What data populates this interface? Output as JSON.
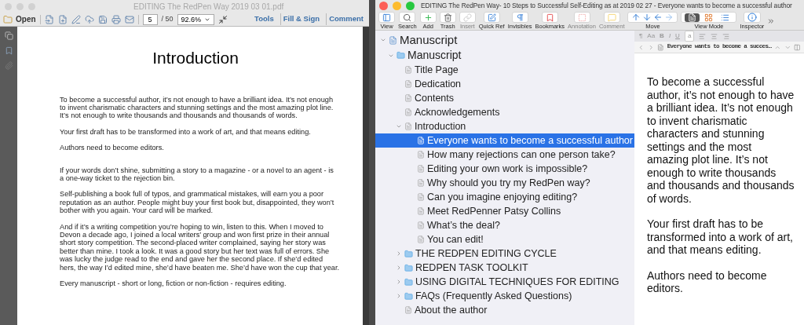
{
  "pdf_window": {
    "title": "EDITING The RedPen Way 2019 03 01.pdf",
    "toolbar": {
      "open": "Open",
      "page": "5",
      "page_total": "/ 50",
      "zoom": "92.6%",
      "links": [
        "Tools",
        "Fill & Sign",
        "Comment"
      ]
    },
    "page": {
      "heading": "Introduction",
      "paragraphs": [
        "To become a successful author, it’s not enough to have a brilliant idea. It’s not enough to invent charismatic characters and stunning settings and the most amazing plot line. It’s not enough to write thousands and thousands and thousands of words.",
        "Your first draft has to be transformed into a work of art, and that means editing.",
        "Authors need to become editors.",
        "If your words don’t shine, submitting a story to a magazine - or a novel to an agent - is a one-way ticket to the rejection bin.",
        "Self-publishing a book full of typos, and grammatical mistakes, will earn you a poor reputation as an author. People might buy your first book but, disappointed, they won’t bother with you again. Your card will be marked.",
        "And if it’s a writing competition you’re hoping to win, listen to this. When I moved to Devon a decade ago, I joined a local writers’ group and won first prize in their annual short story competition. The second-placed writer complained, saying her story was better than mine. I took a look. It was a good story but her text was full of errors. She was lucky the judge read to the end and gave her the second place. If she’d edited hers, the way I’d edited mine, she’d have beaten me. She’d have won the cup that year.",
        "Every manuscript - short or long, fiction or non-fiction - requires editing."
      ]
    }
  },
  "scrivener_window": {
    "title": "EDITING The RedPen Way- 10 Steps to Successful Self-Editing as at 2019 02 27 - Everyone wants to become a successful author",
    "toolbar": [
      {
        "kind": "view",
        "label": "View",
        "disabled": false
      },
      {
        "kind": "search",
        "label": "Search",
        "disabled": false
      },
      {
        "kind": "add",
        "label": "Add",
        "disabled": false
      },
      {
        "kind": "trash",
        "label": "Trash",
        "disabled": false
      },
      {
        "kind": "insert",
        "label": "Insert",
        "disabled": true
      },
      {
        "kind": "quickref",
        "label": "Quick Ref",
        "disabled": false
      },
      {
        "kind": "invisibles",
        "label": "Invisibles",
        "disabled": false
      },
      {
        "kind": "bookmarks",
        "label": "Bookmarks",
        "disabled": false
      },
      {
        "kind": "annotation",
        "label": "Annotation",
        "disabled": true
      },
      {
        "kind": "comment",
        "label": "Comment",
        "disabled": true
      },
      {
        "kind": "move",
        "label": "Move",
        "disabled": false
      },
      {
        "kind": "viewmode",
        "label": "View Mode",
        "disabled": false
      },
      {
        "kind": "inspector",
        "label": "Inspector",
        "disabled": false
      }
    ],
    "binder": [
      {
        "kind": "root",
        "label": "Manuscript",
        "expanded": true,
        "selected": false,
        "children": [
          {
            "kind": "folder",
            "label": "Manuscript",
            "expanded": true,
            "selected": false,
            "children": [
              {
                "kind": "doc",
                "label": "Title Page",
                "selected": false
              },
              {
                "kind": "doc",
                "label": "Dedication",
                "selected": false
              },
              {
                "kind": "doc",
                "label": "Contents",
                "selected": false
              },
              {
                "kind": "doc",
                "label": "Acknowledgements",
                "selected": false
              },
              {
                "kind": "doc",
                "label": "Introduction",
                "expanded": true,
                "selected": false,
                "children": [
                  {
                    "kind": "doc",
                    "label": "Everyone wants to become a successful author",
                    "selected": true
                  },
                  {
                    "kind": "doc",
                    "label": "How many rejections can one person take?",
                    "selected": false
                  },
                  {
                    "kind": "doc",
                    "label": "Editing your own work is impossible?",
                    "selected": false
                  },
                  {
                    "kind": "doc",
                    "label": "Why should you try my RedPen way?",
                    "selected": false
                  },
                  {
                    "kind": "doc",
                    "label": "Can you imagine enjoying editing?",
                    "selected": false
                  },
                  {
                    "kind": "doc",
                    "label": "Meet RedPenner Patsy Collins",
                    "selected": false
                  },
                  {
                    "kind": "doc",
                    "label": "What’s the deal?",
                    "selected": false
                  },
                  {
                    "kind": "doc",
                    "label": "You can edit!",
                    "selected": false
                  }
                ]
              },
              {
                "kind": "folder",
                "label": "THE REDPEN EDITING CYCLE",
                "expanded": false,
                "selected": false
              },
              {
                "kind": "folder",
                "label": "REDPEN TASK TOOLKIT",
                "expanded": false,
                "selected": false
              },
              {
                "kind": "folder",
                "label": "USING DIGITAL TECHNIQUES FOR EDITING",
                "expanded": false,
                "selected": false
              },
              {
                "kind": "folder",
                "label": "FAQs (Frequently Asked Questions)",
                "expanded": false,
                "selected": false
              },
              {
                "kind": "doc",
                "label": "About the author",
                "selected": false
              }
            ]
          }
        ]
      }
    ],
    "editor": {
      "format_bar": [
        "¶",
        "Aa",
        "B",
        "I",
        "U",
        "a"
      ],
      "header_title": "Everyone wants to become a succes…",
      "paragraphs": [
        "To become a successful author, it’s not enough to have a brilliant idea. It’s not enough to invent charismatic characters and stunning settings and the most amazing plot line. It’s not enough to write thousands and thousands and thousands of words.",
        "Your first draft has to be transformed into a work of art, and that means editing.",
        "Authors need to become editors."
      ]
    }
  }
}
